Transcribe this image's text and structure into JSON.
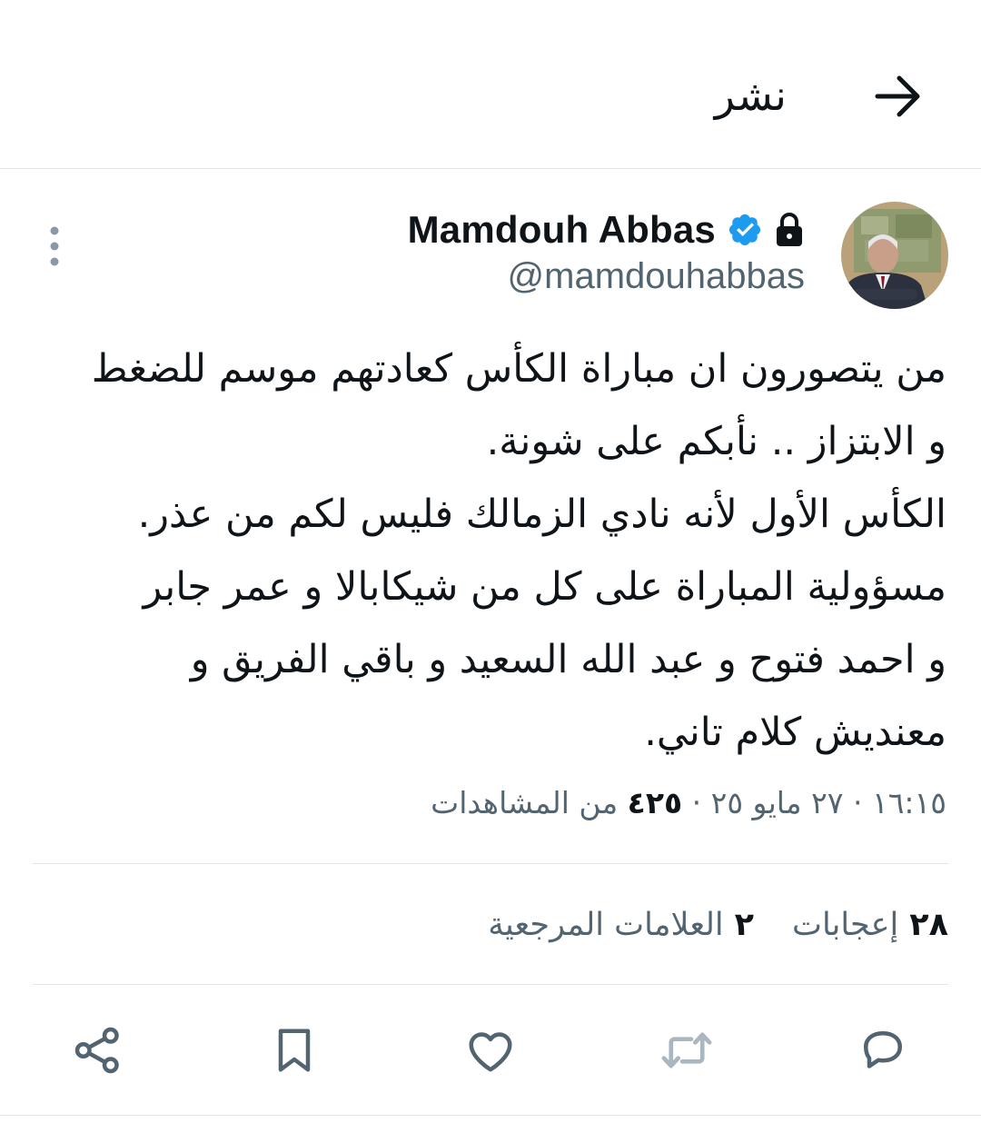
{
  "header": {
    "title": "نشر",
    "back_icon": "arrow-right-icon"
  },
  "author": {
    "display_name": "Mamdouh Abbas",
    "handle": "@mamdouhabbas",
    "verified_icon": "verified-badge-icon",
    "protected_icon": "lock-icon",
    "verified_color": "#1d9bf0"
  },
  "tweet": {
    "lines": [
      "من يتصورون ان مباراة الكأس كعادتهم موسم للضغط",
      "و الابتزاز .. نأبكم على شونة.",
      "الكأس الأول لأنه نادي الزمالك فليس لكم من عذر.",
      "مسؤولية المباراة على كل من شيكابالا و عمر جابر",
      "و احمد فتوح و عبد الله السعيد و باقي الفريق و",
      "معنديش كلام تاني."
    ],
    "time": "١٦:١٥",
    "date": "٢٧ مايو ٢٥",
    "views_count": "٤٢٥",
    "views_label": "من المشاهدات",
    "separator": "·"
  },
  "stats": {
    "likes_count": "٢٨",
    "likes_label": "إعجابات",
    "bookmarks_count": "٢",
    "bookmarks_label": "العلامات المرجعية"
  },
  "actions": [
    "reply-icon",
    "retweet-icon",
    "like-icon",
    "bookmark-icon",
    "share-icon"
  ],
  "colors": {
    "text": "#0f1419",
    "secondary": "#536471",
    "divider": "#e1e6ea",
    "accent": "#1d9bf0"
  }
}
